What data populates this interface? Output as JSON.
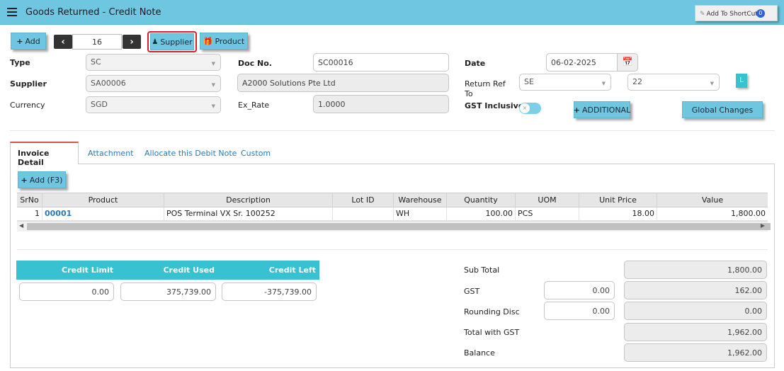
{
  "header": {
    "title": "Goods Returned - Credit Note",
    "shortcut_label": "Add To ShortCut",
    "shortcut_count": "0"
  },
  "toolbar": {
    "add_label": "Add",
    "record_number": "16",
    "supplier_label": "Supplier",
    "product_label": "Product"
  },
  "form": {
    "type_label": "Type",
    "type_value": "SC",
    "supplier_label": "Supplier",
    "supplier_value": "SA00006",
    "currency_label": "Currency",
    "currency_value": "SGD",
    "doc_no_label": "Doc No.",
    "doc_no_value": "SC00016",
    "supplier_name": "A2000 Solutions Pte Ltd",
    "ex_rate_label": "Ex_Rate",
    "ex_rate_value": "1.0000",
    "date_label": "Date",
    "date_value": "06-02-2025",
    "return_ref_label_1": "Return Ref",
    "return_ref_label_2": "To",
    "return_ref_value": "SE",
    "return_ref_no": "22",
    "l_badge": "L",
    "gst_inclusive_label": "GST Inclusive",
    "additional_label": "ADDITIONAL",
    "global_changes_label": "Global Changes"
  },
  "tabs": [
    {
      "label": "Invoice Detail",
      "active": true
    },
    {
      "label": "Attachment",
      "active": false
    },
    {
      "label": "Allocate this Debit Note",
      "active": false
    },
    {
      "label": "Custom",
      "active": false
    }
  ],
  "grid": {
    "add_label": "Add (F3)",
    "columns": [
      "SrNo",
      "Product",
      "Description",
      "Lot ID",
      "Warehouse",
      "Quantity",
      "UOM",
      "Unit Price",
      "Value"
    ],
    "rows": [
      {
        "srno": "1",
        "product": "00001",
        "description": "POS Terminal VX Sr. 100252",
        "lot_id": "",
        "warehouse": "WH",
        "quantity": "100.00",
        "uom": "PCS",
        "unit_price": "18.00",
        "value": "1,800.00"
      }
    ]
  },
  "credit": {
    "limit_label": "Credit Limit",
    "used_label": "Credit Used",
    "left_label": "Credit Left",
    "limit_value": "0.00",
    "used_value": "375,739.00",
    "left_value": "-375,739.00"
  },
  "totals": {
    "sub_total_label": "Sub Total",
    "sub_total_value": "1,800.00",
    "gst_label": "GST",
    "gst_rate_value": "0.00",
    "gst_value": "162.00",
    "rounding_label": "Rounding Disc",
    "rounding_input_value": "0.00",
    "rounding_value": "0.00",
    "total_with_gst_label": "Total with GST",
    "total_with_gst_value": "1,962.00",
    "balance_label": "Balance",
    "balance_value": "1,962.00"
  },
  "colors": {
    "header_bg": "#6ec6e0",
    "accent_teal": "#38c1d0",
    "highlight_red": "#d9202a",
    "link_blue": "#2c78b8"
  }
}
